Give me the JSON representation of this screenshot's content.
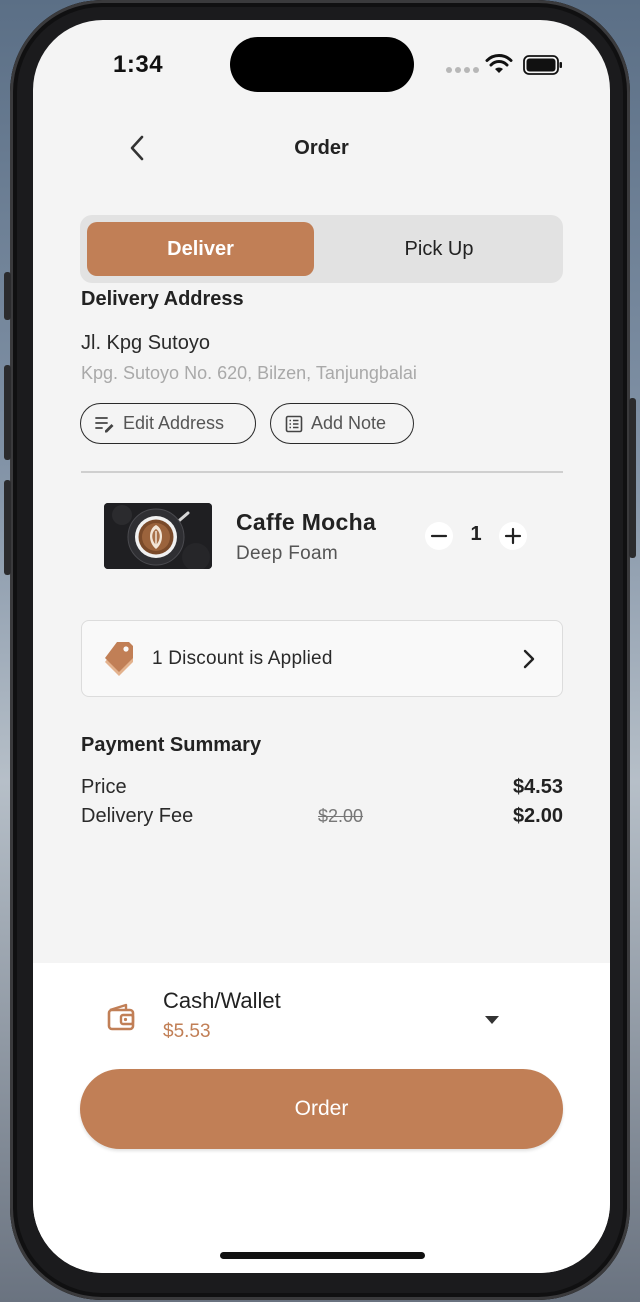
{
  "status_bar": {
    "time": "1:34"
  },
  "header": {
    "title": "Order"
  },
  "order_type": {
    "deliver_label": "Deliver",
    "pickup_label": "Pick Up",
    "selected": "Deliver"
  },
  "delivery": {
    "section_title": "Delivery Address",
    "street": "Jl. Kpg Sutoyo",
    "detail": "Kpg. Sutoyo No. 620, Bilzen, Tanjungbalai",
    "edit_label": "Edit Address",
    "note_label": "Add Note"
  },
  "item": {
    "name": "Caffe Mocha",
    "variant": "Deep Foam",
    "quantity": "1"
  },
  "discount": {
    "text": "1 Discount is Applied"
  },
  "payment_summary": {
    "title": "Payment Summary",
    "price_label": "Price",
    "price_value": "$4.53",
    "fee_label": "Delivery Fee",
    "fee_original": "$2.00",
    "fee_value": "$2.00"
  },
  "payment": {
    "method": "Cash/Wallet",
    "amount": "$5.53"
  },
  "order_button": {
    "label": "Order"
  },
  "colors": {
    "accent": "#C17F56",
    "background": "#F4F4F4",
    "segment_bg": "#E2E2E2"
  },
  "icons": [
    "back-icon",
    "edit-icon",
    "note-icon",
    "minus-icon",
    "plus-icon",
    "discount-tag-icon",
    "chevron-right-icon",
    "wallet-icon",
    "dropdown-icon",
    "wifi-icon",
    "battery-icon"
  ]
}
